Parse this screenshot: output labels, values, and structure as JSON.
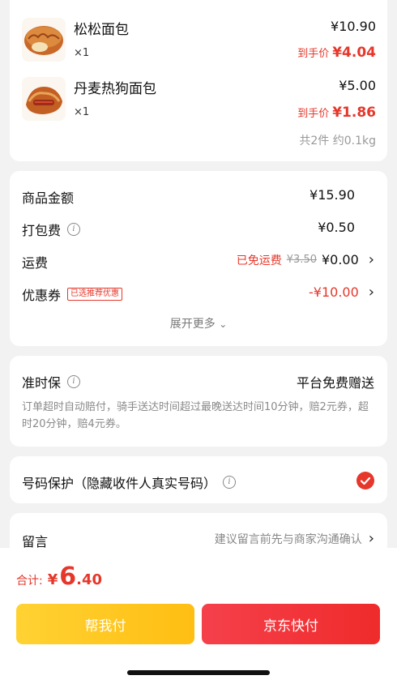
{
  "products": [
    {
      "name": "松松面包",
      "qty": "×1",
      "price": "¥10.90",
      "hand_label": "到手价",
      "hand_price": "¥4.04"
    },
    {
      "name": "丹麦热狗面包",
      "qty": "×1",
      "price": "¥5.00",
      "hand_label": "到手价",
      "hand_price": "¥1.86"
    }
  ],
  "products_summary": "共2件 约0.1kg",
  "fees": {
    "goods_label": "商品金额",
    "goods_value": "¥15.90",
    "packing_label": "打包费",
    "packing_value": "¥0.50",
    "shipping_label": "运费",
    "shipping_free": "已免运费",
    "shipping_original": "¥3.50",
    "shipping_value": "¥0.00",
    "coupon_label": "优惠券",
    "coupon_tag": "已选推荐优惠",
    "coupon_value": "-¥10.00",
    "expand_label": "展开更多"
  },
  "ontime": {
    "title": "准时保",
    "right": "平台免费赠送",
    "desc": "订单超时自动赔付，骑手送达时间超过最晚送达时间10分钟，赔2元券，超时20分钟，赔4元券。"
  },
  "privacy": {
    "label": "号码保护（隐藏收件人真实号码）",
    "checked": true
  },
  "note": {
    "label": "留言",
    "hint": "建议留言前先与商家沟通确认"
  },
  "footer": {
    "total_label": "合计:",
    "total_symbol": "¥",
    "total_int": "6",
    "total_dec": ".40",
    "pay_for_me_label": "帮我付",
    "jd_pay_label": "京东快付"
  },
  "colors": {
    "accent_red": "#e6372a",
    "yellow": "#ffc21a",
    "red_button": "#f2333f"
  }
}
